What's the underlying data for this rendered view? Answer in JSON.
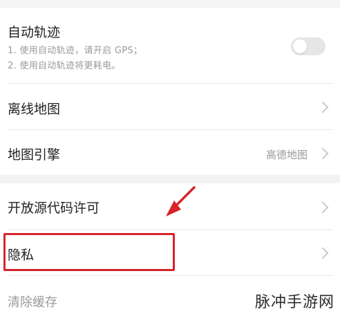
{
  "auto_track": {
    "title": "自动轨迹",
    "desc_line1": "1. 使用自动轨迹，请开启 GPS；",
    "desc_line2": "2. 使用自动轨迹将更耗电。",
    "toggle_on": false
  },
  "offline_map": {
    "title": "离线地图"
  },
  "map_engine": {
    "title": "地图引擎",
    "value": "高德地图"
  },
  "open_source": {
    "title": "开放源代码许可"
  },
  "privacy": {
    "title": "隐私"
  },
  "clear_cache": {
    "title": "清除缓存"
  },
  "watermark": "脉冲手游网",
  "colors": {
    "highlight": "#d8232a",
    "background": "#f2f2f2"
  }
}
